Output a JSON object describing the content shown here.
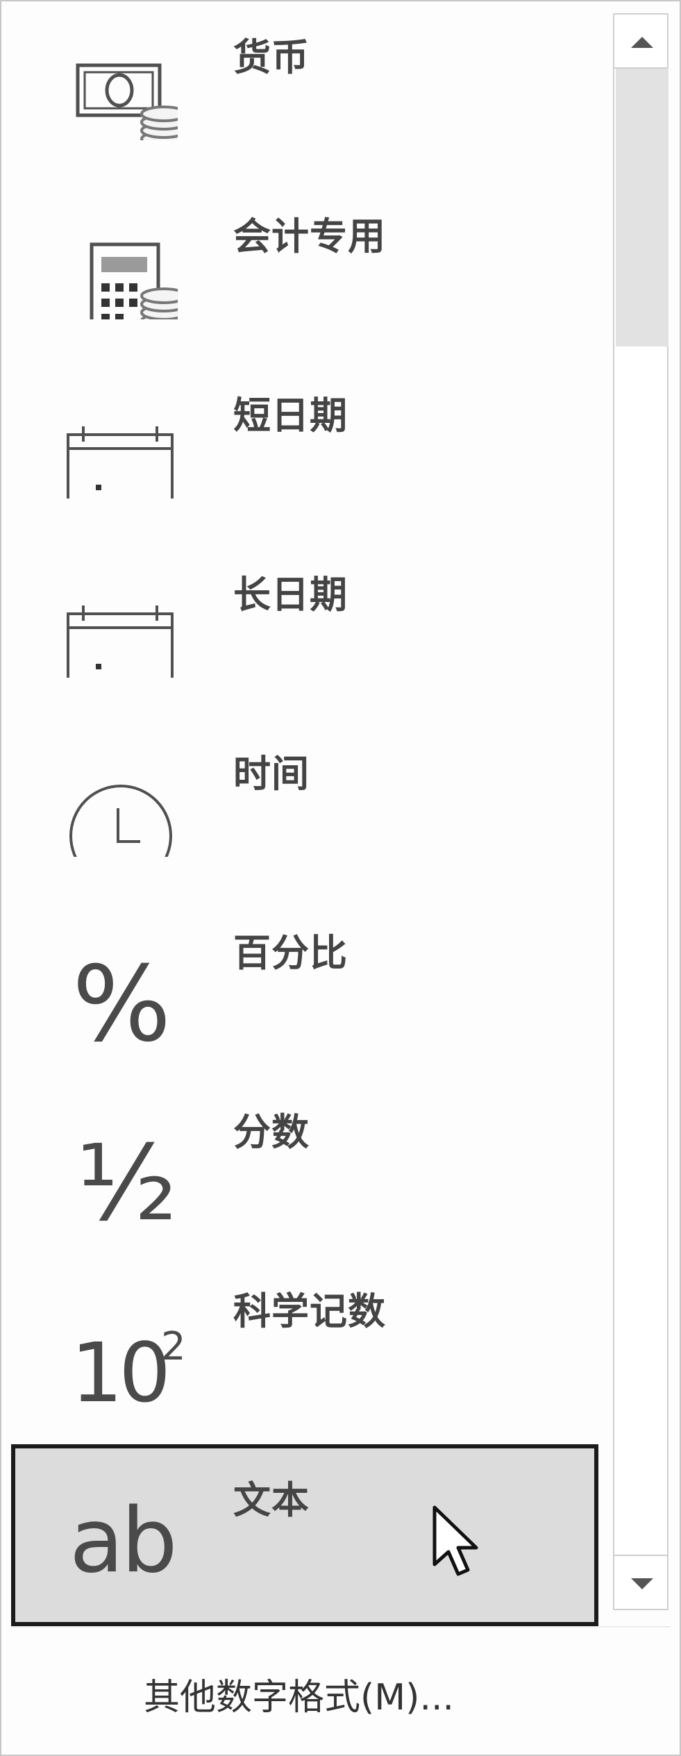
{
  "menu": {
    "items": [
      {
        "id": "currency",
        "label": "货币",
        "icon": "currency-icon"
      },
      {
        "id": "accounting",
        "label": "会计专用",
        "icon": "accounting-icon"
      },
      {
        "id": "short-date",
        "label": "短日期",
        "icon": "calendar-icon"
      },
      {
        "id": "long-date",
        "label": "长日期",
        "icon": "calendar-icon"
      },
      {
        "id": "time",
        "label": "时间",
        "icon": "clock-icon"
      },
      {
        "id": "percentage",
        "label": "百分比",
        "icon": "percent-icon",
        "glyph": "%"
      },
      {
        "id": "fraction",
        "label": "分数",
        "icon": "fraction-icon",
        "glyph": "½"
      },
      {
        "id": "scientific",
        "label": "科学记数",
        "icon": "scientific-icon",
        "glyph_base": "10",
        "glyph_sup": "2"
      },
      {
        "id": "text",
        "label": "文本",
        "icon": "text-format-icon",
        "glyph": "ab",
        "selected": true
      }
    ],
    "more_formats": "其他数字格式(M)..."
  },
  "colors": {
    "selected_background": "#dcdcdc",
    "selected_border": "#1b1b1b",
    "label_text": "#444444"
  }
}
